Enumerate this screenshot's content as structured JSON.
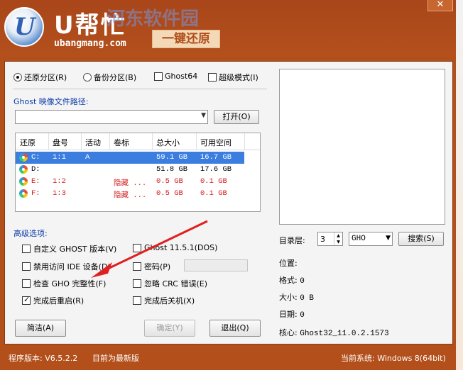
{
  "header": {
    "logo_letter": "U",
    "title": "U帮忙",
    "watermark": "河东软件园",
    "url": "ubangmang.com",
    "badge": "一键还原",
    "close_symbol": "✕"
  },
  "mode_options": [
    {
      "label": "还原分区(R)",
      "type": "radio",
      "checked": true
    },
    {
      "label": "备份分区(B)",
      "type": "radio",
      "checked": false
    },
    {
      "label": "Ghost64",
      "type": "checkbox",
      "checked": false
    },
    {
      "label": "超级模式(I)",
      "type": "checkbox",
      "checked": false
    }
  ],
  "ghost_path": {
    "label": "Ghost 映像文件路径:",
    "value": "",
    "open_button": "打开(O)"
  },
  "partition_table": {
    "columns": [
      "还原",
      "盘号",
      "活动",
      "卷标",
      "总大小",
      "可用空间"
    ],
    "rows": [
      {
        "drive": "C:",
        "num": "1:1",
        "active": "A",
        "label": "",
        "total": "59.1 GB",
        "free": "16.7 GB",
        "selected": true,
        "hidden": false
      },
      {
        "drive": "D:",
        "num": "",
        "active": "",
        "label": "",
        "total": "51.8 GB",
        "free": "17.6 GB",
        "selected": false,
        "hidden": false
      },
      {
        "drive": "E:",
        "num": "1:2",
        "active": "",
        "label": "隐藏 ...",
        "total": "0.5 GB",
        "free": "0.1 GB",
        "selected": false,
        "hidden": true
      },
      {
        "drive": "F:",
        "num": "1:3",
        "active": "",
        "label": "隐藏 ...",
        "total": "0.5 GB",
        "free": "0.1 GB",
        "selected": false,
        "hidden": true
      }
    ]
  },
  "advanced": {
    "label": "高级选项:",
    "items": [
      {
        "label": "自定义 GHOST 版本(V)",
        "checked": false
      },
      {
        "label": "Ghost 11.5.1(DOS)",
        "checked": false
      },
      {
        "label": "禁用访问 IDE 设备(D)",
        "checked": false
      },
      {
        "label": "密码(P)",
        "checked": false
      },
      {
        "label": "检查 GHO 完整性(F)",
        "checked": false
      },
      {
        "label": "忽略 CRC 错误(E)",
        "checked": false
      },
      {
        "label": "完成后重启(R)",
        "checked": true
      },
      {
        "label": "完成后关机(X)",
        "checked": false
      }
    ],
    "password_value": ""
  },
  "buttons": {
    "simple": "简洁(A)",
    "ok": "确定(Y)",
    "exit": "退出(Q)",
    "search": "搜索(S)"
  },
  "right_panel": {
    "dir_level_label": "目录层:",
    "dir_level_value": "3",
    "ext_value": "GHO",
    "position_label": "位置:",
    "position_value": "",
    "format_label": "格式:",
    "format_value": "0",
    "size_label": "大小:",
    "size_value": "0 B",
    "date_label": "日期:",
    "date_value": "0",
    "core_label": "核心:",
    "core_value": "Ghost32_11.0.2.1573"
  },
  "status": {
    "version": "程序版本: V6.5.2.2",
    "latest": "目前为最新版",
    "system": "当前系统: Windows 8(64bit)"
  },
  "colors": {
    "frame": "#b24f1b",
    "accent_blue": "#0a3ca8",
    "selection": "#3b7ee0",
    "hidden_red": "#d21c1c",
    "annotation_arrow": "#e02020"
  },
  "icons": {
    "logo": "u-logo-icon",
    "disk": "disk-icon",
    "close": "close-icon",
    "dropdown": "chevron-down-icon",
    "annotation": "red-arrow-icon"
  }
}
